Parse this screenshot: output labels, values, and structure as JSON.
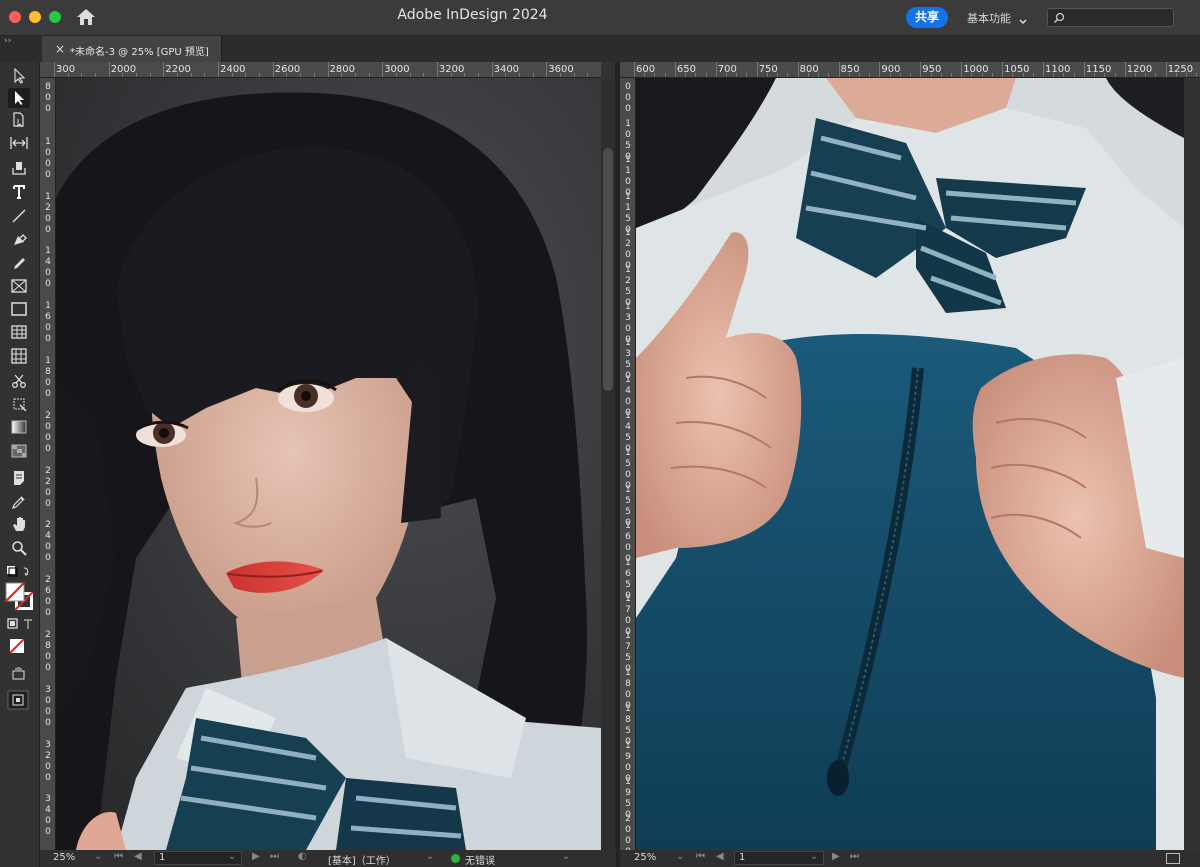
{
  "window": {
    "title": "Adobe InDesign 2024"
  },
  "header": {
    "share_label": "共享",
    "workspace_label": "基本功能",
    "search_placeholder": ""
  },
  "document_tab": {
    "close_glyph": "×",
    "title": "*未命名-3 @ 25% [GPU 预览]"
  },
  "panel_collapse": "››",
  "left_pane": {
    "ruler_h": [
      "300",
      "2000",
      "2200",
      "2400",
      "2600",
      "2800",
      "3000",
      "3200",
      "3400",
      "3600",
      "3"
    ],
    "ruler_v": [
      "8\n0\n0",
      "1\n0\n0\n0",
      "1\n2\n0\n0",
      "1\n4\n0\n0",
      "1\n6\n0\n0",
      "1\n8\n0\n0",
      "2\n0\n0\n0",
      "2\n2\n0\n0",
      "2\n4\n0\n0",
      "2\n6\n0\n0",
      "2\n8\n0\n0",
      "3\n0\n0\n0",
      "3\n2\n0\n0",
      "3\n4\n0\n0"
    ],
    "status": {
      "zoom": "25%",
      "page": "1",
      "preflight_profile": "[基本]（工作）",
      "preflight_status": "无错误"
    }
  },
  "right_pane": {
    "ruler_h": [
      "600",
      "650",
      "700",
      "750",
      "800",
      "850",
      "900",
      "950",
      "1000",
      "1050",
      "1100",
      "1150",
      "1200",
      "1250"
    ],
    "ruler_v": [
      "0\n0\n0",
      "1\n0\n5\n0",
      "1\n1\n0\n0",
      "1\n1\n5\n0",
      "1\n2\n0\n0",
      "1\n2\n5\n0",
      "1\n3\n0\n0",
      "1\n3\n5\n0",
      "1\n4\n0\n0",
      "1\n4\n5\n0",
      "1\n5\n0\n0",
      "1\n5\n5\n0",
      "1\n6\n0\n0",
      "1\n6\n5\n0",
      "1\n7\n0\n0",
      "1\n7\n5\n0",
      "1\n8\n0\n0",
      "1\n8\n5\n0",
      "1\n9\n0\n0",
      "1\n9\n5\n0",
      "2\n0\n0\n0"
    ],
    "status": {
      "zoom": "25%",
      "page": "1"
    }
  },
  "tools": [
    "selection-tool",
    "direct-selection-tool",
    "page-tool",
    "gap-tool",
    "content-collector-tool",
    "type-tool",
    "line-tool",
    "pen-tool",
    "pencil-tool",
    "rectangle-frame-tool",
    "rectangle-tool",
    "table-tool",
    "grid-tool",
    "scissors-tool",
    "free-transform-tool",
    "gradient-swatch-tool",
    "gradient-feather-tool",
    "note-tool",
    "eyedropper-tool",
    "hand-tool",
    "zoom-tool"
  ]
}
